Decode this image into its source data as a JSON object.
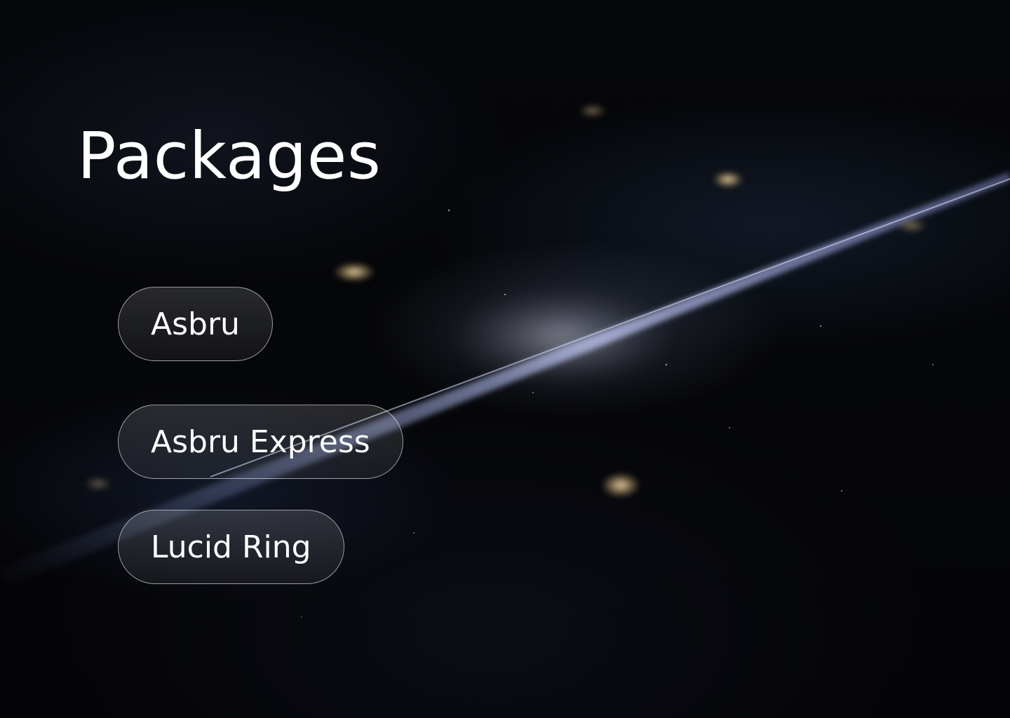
{
  "page": {
    "title": "Packages"
  },
  "packages": [
    {
      "label": "Asbru"
    },
    {
      "label": "Asbru Express"
    },
    {
      "label": "Lucid Ring"
    }
  ],
  "colors": {
    "background": "#030305",
    "text": "#ffffff",
    "pill_border": "#ffffff"
  }
}
